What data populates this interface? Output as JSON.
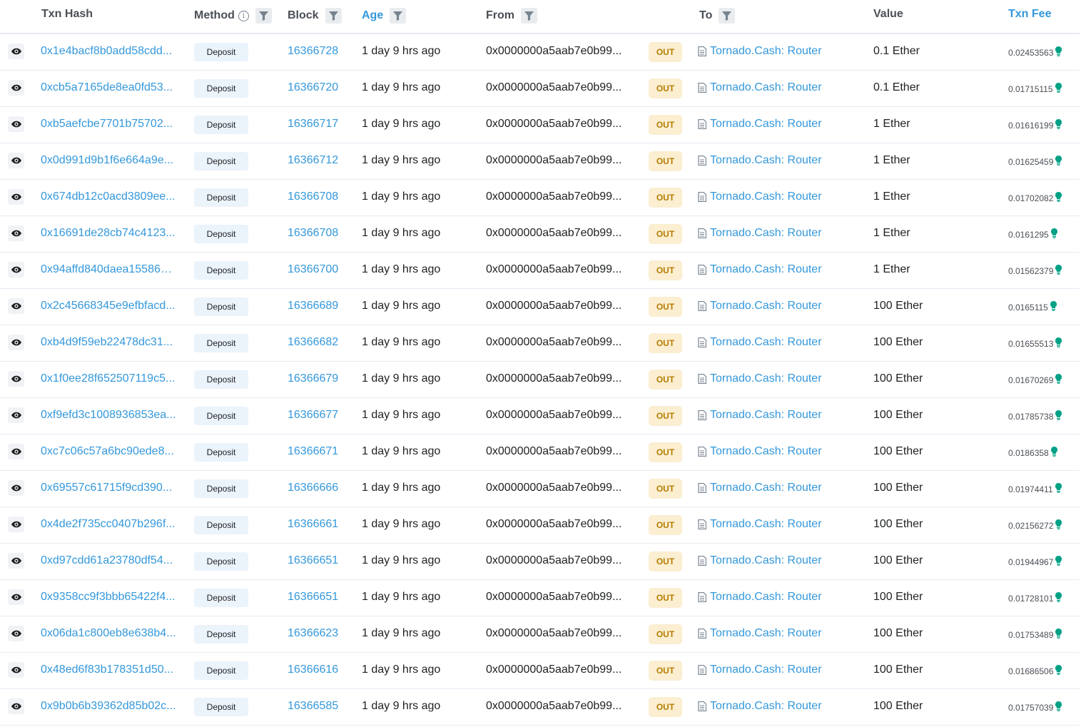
{
  "colors": {
    "link": "#3498db",
    "out_badge_bg": "#fbeed1",
    "out_badge_text": "#b47d00",
    "method_bg": "#ebf3fb",
    "fee_bulb": "#00a186"
  },
  "header": {
    "txn_hash": "Txn Hash",
    "method": "Method",
    "method_info": "i",
    "block": "Block",
    "age": "Age",
    "from": "From",
    "to": "To",
    "value": "Value",
    "txn_fee": "Txn Fee"
  },
  "icons": {
    "eye": "eye-icon",
    "filter": "filter-icon",
    "info": "info-icon",
    "contract": "document-icon",
    "gas": "lightbulb-icon"
  },
  "rows": [
    {
      "hash": "0x1e4bacf8b0add58cdd...",
      "method": "Deposit",
      "block": "16366728",
      "age": "1 day 9 hrs ago",
      "from": "0x0000000a5aab7e0b99...",
      "direction": "OUT",
      "to": "Tornado.Cash: Router",
      "value": "0.1 Ether",
      "fee": "0.02453563"
    },
    {
      "hash": "0xcb5a7165de8ea0fd53...",
      "method": "Deposit",
      "block": "16366720",
      "age": "1 day 9 hrs ago",
      "from": "0x0000000a5aab7e0b99...",
      "direction": "OUT",
      "to": "Tornado.Cash: Router",
      "value": "0.1 Ether",
      "fee": "0.01715115"
    },
    {
      "hash": "0xb5aefcbe7701b75702...",
      "method": "Deposit",
      "block": "16366717",
      "age": "1 day 9 hrs ago",
      "from": "0x0000000a5aab7e0b99...",
      "direction": "OUT",
      "to": "Tornado.Cash: Router",
      "value": "1 Ether",
      "fee": "0.01616199"
    },
    {
      "hash": "0x0d991d9b1f6e664a9e...",
      "method": "Deposit",
      "block": "16366712",
      "age": "1 day 9 hrs ago",
      "from": "0x0000000a5aab7e0b99...",
      "direction": "OUT",
      "to": "Tornado.Cash: Router",
      "value": "1 Ether",
      "fee": "0.01625459"
    },
    {
      "hash": "0x674db12c0acd3809ee...",
      "method": "Deposit",
      "block": "16366708",
      "age": "1 day 9 hrs ago",
      "from": "0x0000000a5aab7e0b99...",
      "direction": "OUT",
      "to": "Tornado.Cash: Router",
      "value": "1 Ether",
      "fee": "0.01702082"
    },
    {
      "hash": "0x16691de28cb74c4123...",
      "method": "Deposit",
      "block": "16366708",
      "age": "1 day 9 hrs ago",
      "from": "0x0000000a5aab7e0b99...",
      "direction": "OUT",
      "to": "Tornado.Cash: Router",
      "value": "1 Ether",
      "fee": "0.0161295"
    },
    {
      "hash": "0x94affd840daea155866...",
      "method": "Deposit",
      "block": "16366700",
      "age": "1 day 9 hrs ago",
      "from": "0x0000000a5aab7e0b99...",
      "direction": "OUT",
      "to": "Tornado.Cash: Router",
      "value": "1 Ether",
      "fee": "0.01562379"
    },
    {
      "hash": "0x2c45668345e9efbfacd...",
      "method": "Deposit",
      "block": "16366689",
      "age": "1 day 9 hrs ago",
      "from": "0x0000000a5aab7e0b99...",
      "direction": "OUT",
      "to": "Tornado.Cash: Router",
      "value": "100 Ether",
      "fee": "0.0165115"
    },
    {
      "hash": "0xb4d9f59eb22478dc31...",
      "method": "Deposit",
      "block": "16366682",
      "age": "1 day 9 hrs ago",
      "from": "0x0000000a5aab7e0b99...",
      "direction": "OUT",
      "to": "Tornado.Cash: Router",
      "value": "100 Ether",
      "fee": "0.01655513"
    },
    {
      "hash": "0x1f0ee28f652507119c5...",
      "method": "Deposit",
      "block": "16366679",
      "age": "1 day 9 hrs ago",
      "from": "0x0000000a5aab7e0b99...",
      "direction": "OUT",
      "to": "Tornado.Cash: Router",
      "value": "100 Ether",
      "fee": "0.01670269"
    },
    {
      "hash": "0xf9efd3c1008936853ea...",
      "method": "Deposit",
      "block": "16366677",
      "age": "1 day 9 hrs ago",
      "from": "0x0000000a5aab7e0b99...",
      "direction": "OUT",
      "to": "Tornado.Cash: Router",
      "value": "100 Ether",
      "fee": "0.01785738"
    },
    {
      "hash": "0xc7c06c57a6bc90ede8...",
      "method": "Deposit",
      "block": "16366671",
      "age": "1 day 9 hrs ago",
      "from": "0x0000000a5aab7e0b99...",
      "direction": "OUT",
      "to": "Tornado.Cash: Router",
      "value": "100 Ether",
      "fee": "0.0186358"
    },
    {
      "hash": "0x69557c61715f9cd390...",
      "method": "Deposit",
      "block": "16366666",
      "age": "1 day 9 hrs ago",
      "from": "0x0000000a5aab7e0b99...",
      "direction": "OUT",
      "to": "Tornado.Cash: Router",
      "value": "100 Ether",
      "fee": "0.01974411"
    },
    {
      "hash": "0x4de2f735cc0407b296f...",
      "method": "Deposit",
      "block": "16366661",
      "age": "1 day 9 hrs ago",
      "from": "0x0000000a5aab7e0b99...",
      "direction": "OUT",
      "to": "Tornado.Cash: Router",
      "value": "100 Ether",
      "fee": "0.02156272"
    },
    {
      "hash": "0xd97cdd61a23780df54...",
      "method": "Deposit",
      "block": "16366651",
      "age": "1 day 9 hrs ago",
      "from": "0x0000000a5aab7e0b99...",
      "direction": "OUT",
      "to": "Tornado.Cash: Router",
      "value": "100 Ether",
      "fee": "0.01944967"
    },
    {
      "hash": "0x9358cc9f3bbb65422f4...",
      "method": "Deposit",
      "block": "16366651",
      "age": "1 day 9 hrs ago",
      "from": "0x0000000a5aab7e0b99...",
      "direction": "OUT",
      "to": "Tornado.Cash: Router",
      "value": "100 Ether",
      "fee": "0.01728101"
    },
    {
      "hash": "0x06da1c800eb8e638b4...",
      "method": "Deposit",
      "block": "16366623",
      "age": "1 day 9 hrs ago",
      "from": "0x0000000a5aab7e0b99...",
      "direction": "OUT",
      "to": "Tornado.Cash: Router",
      "value": "100 Ether",
      "fee": "0.01753489"
    },
    {
      "hash": "0x48ed6f83b178351d50...",
      "method": "Deposit",
      "block": "16366616",
      "age": "1 day 9 hrs ago",
      "from": "0x0000000a5aab7e0b99...",
      "direction": "OUT",
      "to": "Tornado.Cash: Router",
      "value": "100 Ether",
      "fee": "0.01686506"
    },
    {
      "hash": "0x9b0b6b39362d85b02c...",
      "method": "Deposit",
      "block": "16366585",
      "age": "1 day 9 hrs ago",
      "from": "0x0000000a5aab7e0b99...",
      "direction": "OUT",
      "to": "Tornado.Cash: Router",
      "value": "100 Ether",
      "fee": "0.01757039"
    }
  ]
}
